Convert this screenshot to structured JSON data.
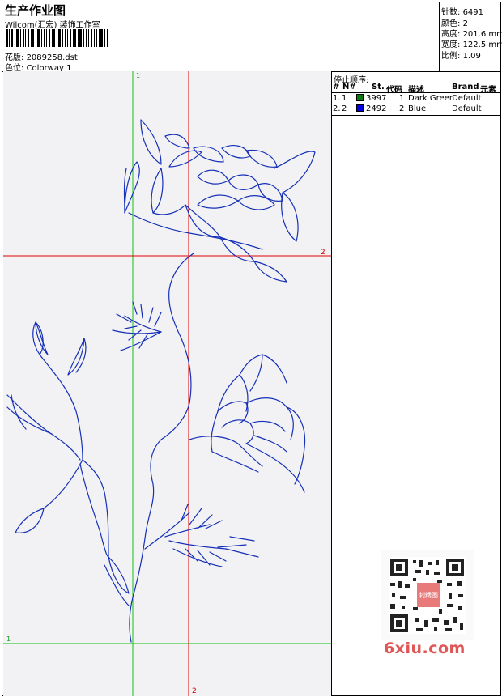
{
  "header": {
    "title": "生产作业图",
    "studio": "Wilcom(汇宏) 装饰工作室",
    "design_label": "花版:",
    "design_file": "2089258.dst",
    "colorway_label": "色位:",
    "colorway": "Colorway 1"
  },
  "stats": [
    {
      "label": "针数:",
      "value": "6491"
    },
    {
      "label": "颜色:",
      "value": "2"
    },
    {
      "label": "高度:",
      "value": "201.6 mm"
    },
    {
      "label": "宽度:",
      "value": "122.5 mm"
    },
    {
      "label": "比例:",
      "value": "1.09"
    }
  ],
  "stop_sequence": {
    "title": "停止顺序:",
    "columns": [
      "#",
      "N#",
      "St.",
      "代码",
      "描述",
      "Brand",
      "元素"
    ],
    "rows": [
      {
        "index": "1.",
        "n": "1",
        "stitches": "3997",
        "code": "1",
        "description": "Dark Green",
        "brand": "Default",
        "color": "#0a7a0a"
      },
      {
        "index": "2.",
        "n": "2",
        "stitches": "2492",
        "code": "2",
        "description": "Blue",
        "brand": "Default",
        "color": "#0000e0"
      }
    ]
  },
  "guides": {
    "vertical_1": "1",
    "vertical_2": "2",
    "horizontal_1": "1",
    "horizontal_2": "2"
  },
  "watermark": "6xiu.com",
  "qr_badge": "刺绣图"
}
